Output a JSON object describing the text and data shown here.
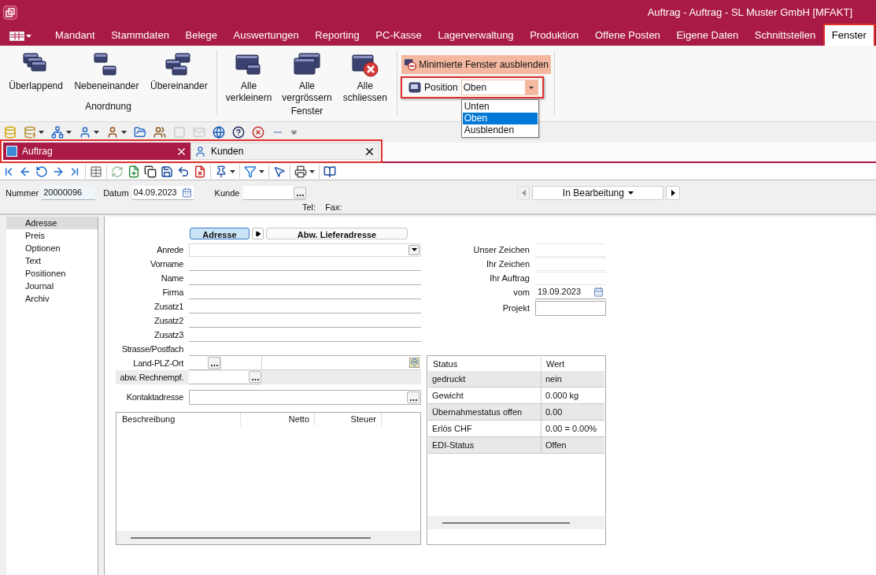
{
  "window": {
    "title": "Auftrag - Auftrag - SL Muster GmbH [MFAKT]"
  },
  "menu": {
    "tabs": [
      {
        "label": "Mandant",
        "selected": false,
        "highlighted": false
      },
      {
        "label": "Stammdaten",
        "selected": false,
        "highlighted": false
      },
      {
        "label": "Belege",
        "selected": false,
        "highlighted": false
      },
      {
        "label": "Auswertungen",
        "selected": false,
        "highlighted": false
      },
      {
        "label": "Reporting",
        "selected": false,
        "highlighted": false
      },
      {
        "label": "PC-Kasse",
        "selected": false,
        "highlighted": false
      },
      {
        "label": "Lagerverwaltung",
        "selected": false,
        "highlighted": false
      },
      {
        "label": "Produktion",
        "selected": false,
        "highlighted": false
      },
      {
        "label": "Offene Posten",
        "selected": false,
        "highlighted": false
      },
      {
        "label": "Eigene Daten",
        "selected": false,
        "highlighted": false
      },
      {
        "label": "Schnittstellen",
        "selected": false,
        "highlighted": false
      },
      {
        "label": "Fenster",
        "selected": true,
        "highlighted": true
      }
    ]
  },
  "ribbon": {
    "groups": [
      {
        "label": "Anordnung",
        "buttons": [
          {
            "label": "Überlappend"
          },
          {
            "label": "Nebeneinander"
          },
          {
            "label": "Übereinander"
          }
        ]
      },
      {
        "label": "Fenster",
        "buttons": [
          {
            "label": "Alle verkleinern"
          },
          {
            "label": "Alle vergrössern"
          },
          {
            "label": "Alle schliessen"
          }
        ]
      }
    ],
    "minimize_button": {
      "label": "Minimierte Fenster ausblenden"
    },
    "position": {
      "label": "Position",
      "value": "Oben",
      "highlighted": true,
      "options": [
        {
          "label": "Unten",
          "selected": false
        },
        {
          "label": "Oben",
          "selected": true
        },
        {
          "label": "Ausblenden",
          "selected": false
        }
      ]
    }
  },
  "document_tabs": {
    "highlighted": true,
    "tabs": [
      {
        "label": "Auftrag",
        "selected": true
      },
      {
        "label": "Kunden",
        "selected": false
      }
    ]
  },
  "header": {
    "nummer": {
      "label": "Nummer",
      "value": "20000096"
    },
    "datum": {
      "label": "Datum",
      "value": "04.09.2023"
    },
    "kunde": {
      "label": "Kunde"
    },
    "tel": "Tel:",
    "fax": "Fax:",
    "status": "In Bearbeitung"
  },
  "nav": [
    {
      "label": "Adresse",
      "selected": true
    },
    {
      "label": "Preis",
      "selected": false
    },
    {
      "label": "Optionen",
      "selected": false
    },
    {
      "label": "Text",
      "selected": false
    },
    {
      "label": "Positionen",
      "selected": false
    },
    {
      "label": "Journal",
      "selected": false
    },
    {
      "label": "Archiv",
      "selected": false
    }
  ],
  "address_tabs": [
    {
      "label": "Adresse",
      "selected": true
    },
    {
      "label": "Abw. Lieferadresse",
      "selected": false
    }
  ],
  "address_fields": [
    {
      "label": "Anrede",
      "kind": "select"
    },
    {
      "label": "Vorname",
      "kind": "text"
    },
    {
      "label": "Name",
      "kind": "text"
    },
    {
      "label": "Firma",
      "kind": "text"
    },
    {
      "label": "Zusatz1",
      "kind": "text"
    },
    {
      "label": "Zusatz2",
      "kind": "text"
    },
    {
      "label": "Zusatz3",
      "kind": "text"
    },
    {
      "label": "Strasse/Postfach",
      "kind": "text"
    },
    {
      "label": "Land-PLZ-Ort",
      "kind": "country"
    },
    {
      "label": "abw. Rechnempf.",
      "kind": "lookup"
    },
    {
      "label": "Kontaktadresse",
      "kind": "lookup_wide"
    }
  ],
  "reference_fields": [
    {
      "label": "Unser Zeichen",
      "kind": "text"
    },
    {
      "label": "Ihr Zeichen",
      "kind": "text"
    },
    {
      "label": "Ihr Auftrag",
      "kind": "text"
    },
    {
      "label": "vom",
      "kind": "date",
      "value": "19.09.2023"
    },
    {
      "label": "Projekt",
      "kind": "boxed"
    }
  ],
  "items_table": {
    "columns": [
      "Beschreibung",
      "Netto",
      "Steuer"
    ]
  },
  "status_table": {
    "columns": [
      "Status",
      "Wert"
    ],
    "rows": [
      [
        "gedruckt",
        "nein"
      ],
      [
        "Gewicht",
        "0.000 kg"
      ],
      [
        "Übernahmestatus offen",
        "0.00"
      ],
      [
        "Erlös CHF",
        "0.00 = 0.00%"
      ],
      [
        "EDI-Status",
        "Offen"
      ]
    ]
  }
}
